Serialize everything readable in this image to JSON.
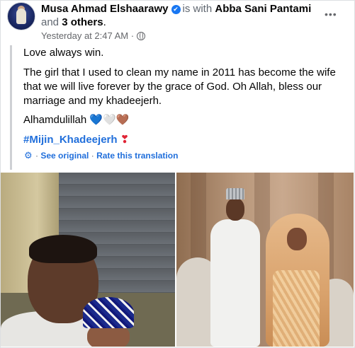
{
  "post": {
    "author": "Musa Ahmad Elshaarawy",
    "with_text": "is with",
    "tagged_person": "Abba Sani Pantami",
    "and_text": "and",
    "others": "3 others",
    "period": ".",
    "timestamp": "Yesterday at 2:47 AM",
    "separator": "·",
    "verified_mark": "✔",
    "more_label": "•••",
    "paragraphs": {
      "p1": "Love always win.",
      "p2": "The girl that I used to clean my name in 2011 has become the wife that we will live forever by the grace of God. Oh Allah, bless our marriage and my khadeejerh.",
      "p3": "Alhamdulillah",
      "p3_emoji": [
        "💙",
        "🤍",
        "🤎"
      ],
      "hashtag": "#Mijin_Khadeejerh",
      "hashtag_emoji": "❣"
    },
    "translation": {
      "gear_glyph": "⚙",
      "see_original": "See original",
      "dot": "·",
      "rate": "Rate this translation"
    }
  },
  "icons": {
    "verified": "verified-badge-icon",
    "globe": "globe-icon",
    "more": "more-options-icon",
    "gear": "gear-icon"
  },
  "colors": {
    "link": "#216fdb",
    "verified": "#1877f2",
    "muted": "#65676b",
    "quote_bar": "#ced0d4"
  }
}
